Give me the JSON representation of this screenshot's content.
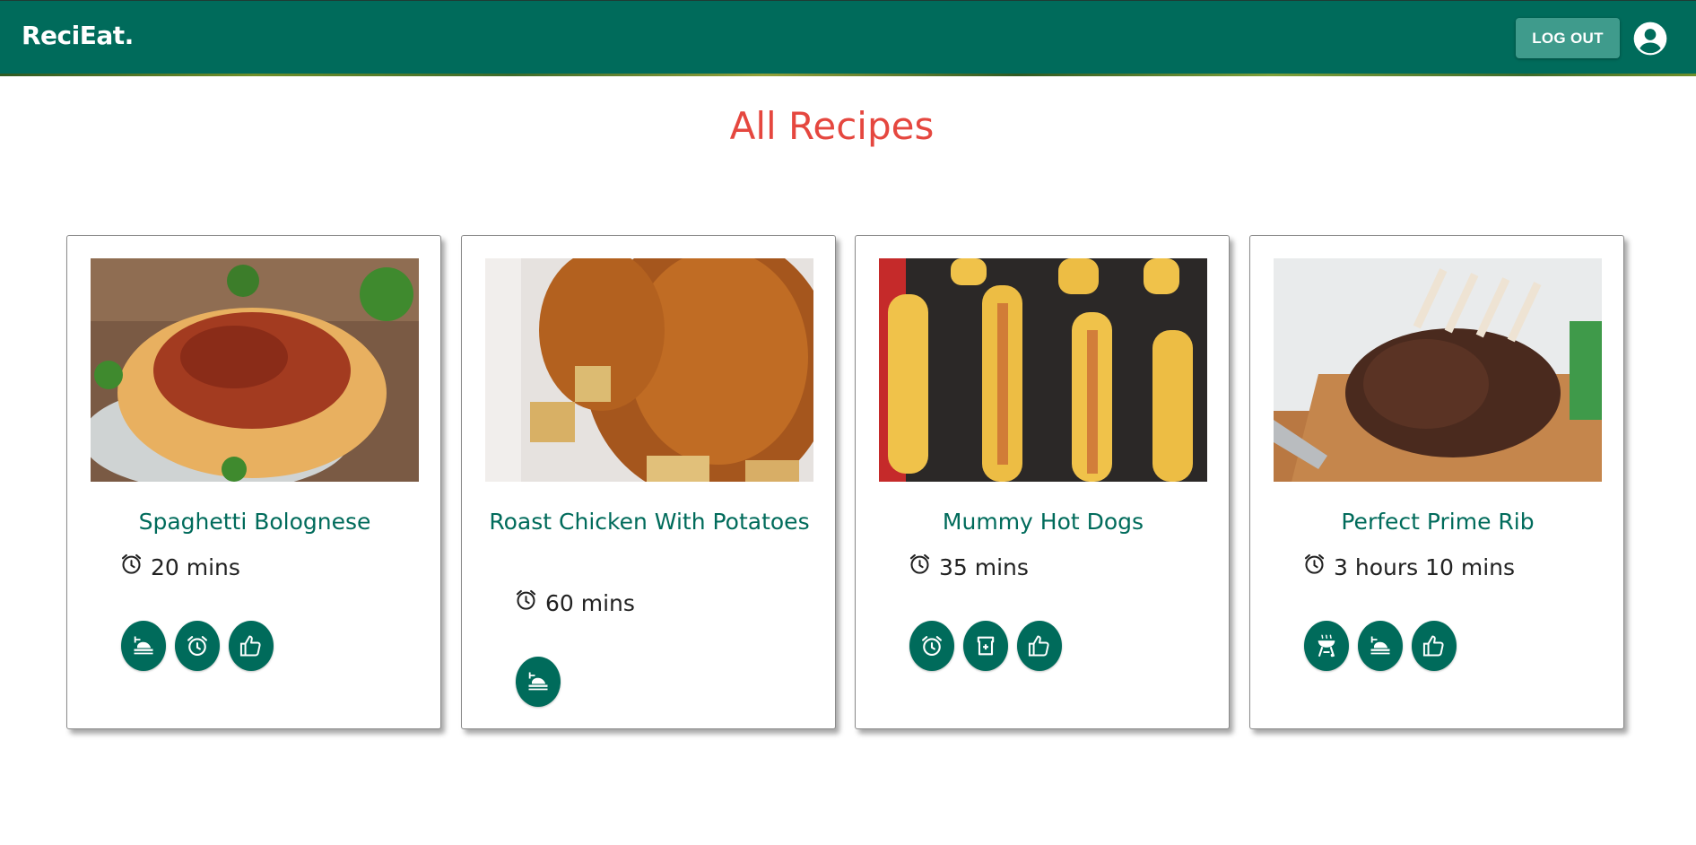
{
  "app": {
    "brand": "ReciEat.",
    "logout_label": "LOG OUT"
  },
  "page": {
    "title": "All Recipes"
  },
  "colors": {
    "header": "#006b5b",
    "title": "#e5473f",
    "accent": "#006b5b",
    "logout_button": "#3f9b8c"
  },
  "recipes": [
    {
      "name": "Spaghetti Bolognese",
      "time": "20 mins",
      "image": "spaghetti-bolognese-photo",
      "tags": [
        "dinner-plate-icon",
        "alarm-clock-icon",
        "thumbs-up-icon"
      ]
    },
    {
      "name": "Roast Chicken With Potatoes",
      "time": "60 mins",
      "image": "roast-chicken-photo",
      "tags": [
        "dinner-plate-icon"
      ]
    },
    {
      "name": "Mummy Hot Dogs",
      "time": "35 mins",
      "image": "mummy-hot-dogs-photo",
      "tags": [
        "alarm-clock-icon",
        "lunchbox-icon",
        "thumbs-up-icon"
      ]
    },
    {
      "name": "Perfect Prime Rib",
      "time": "3 hours 10 mins",
      "image": "prime-rib-photo",
      "tags": [
        "grill-icon",
        "dinner-plate-icon",
        "thumbs-up-icon"
      ]
    }
  ]
}
